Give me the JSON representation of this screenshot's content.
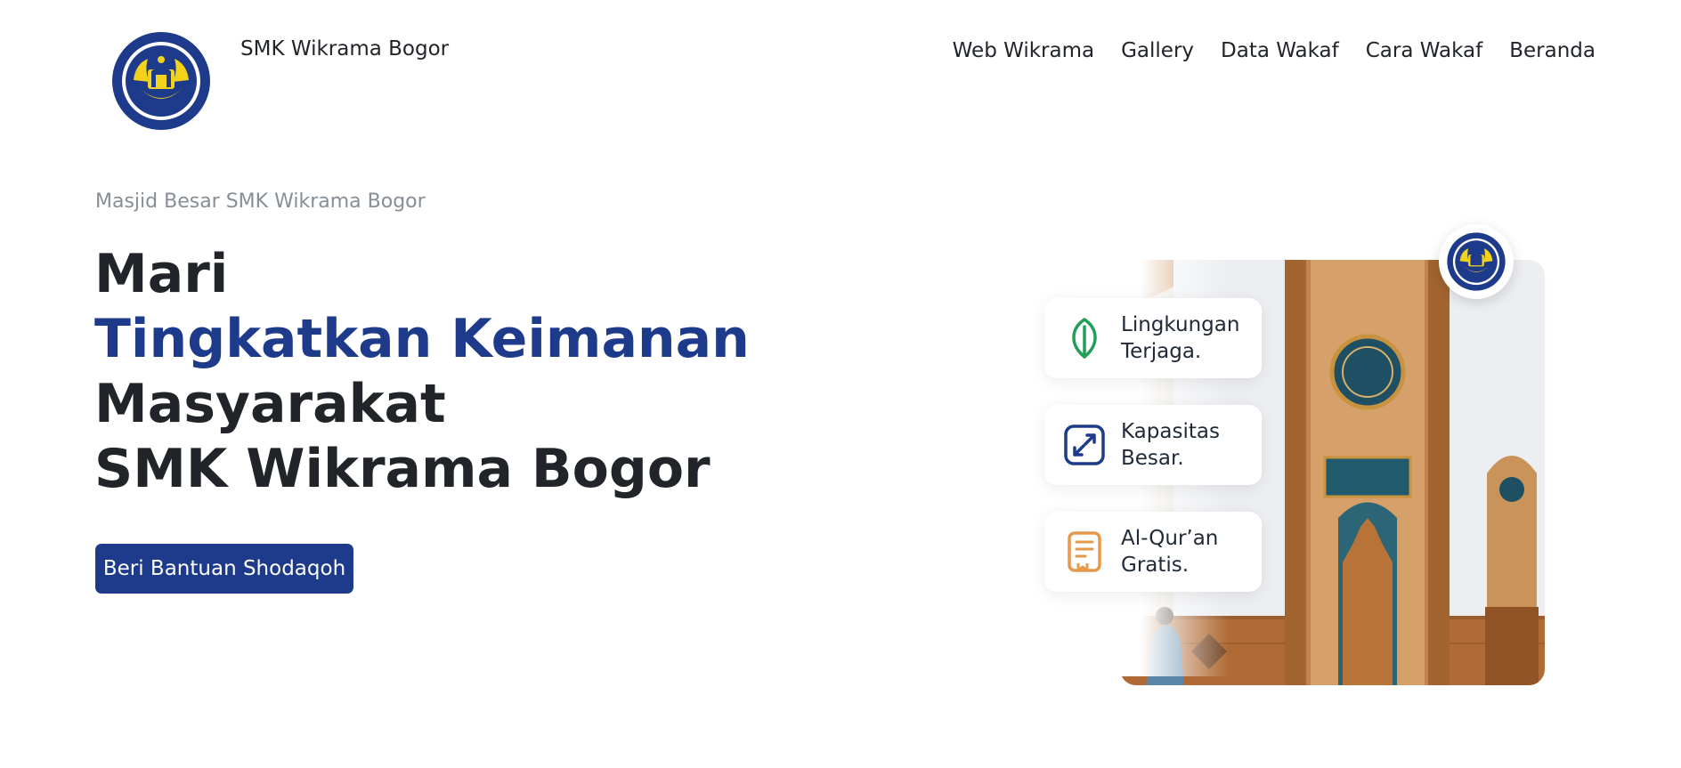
{
  "brand": {
    "name": "SMK Wikrama Bogor",
    "logo_icon": "smk-wikrama-logo"
  },
  "nav": {
    "items": [
      "Web Wikrama",
      "Gallery",
      "Data Wakaf",
      "Cara Wakaf",
      "Beranda"
    ]
  },
  "hero": {
    "eyebrow": "Masjid Besar SMK Wikrama Bogor",
    "headline": [
      "Mari",
      "Tingkatkan Keimanan",
      "Masyarakat",
      "SMK Wikrama Bogor"
    ],
    "cta_label": "Beri Bantuan Shodaqoh",
    "features": [
      {
        "line1": "Lingkungan",
        "line2": "Terjaga.",
        "icon": "leaf-icon"
      },
      {
        "line1": "Kapasitas",
        "line2": "Besar.",
        "icon": "expand-icon"
      },
      {
        "line1": "Al-Qur’an",
        "line2": "Gratis.",
        "icon": "book-icon"
      }
    ]
  },
  "colors": {
    "primary": "#1e3a8a",
    "leaf_icon": "#22a05a",
    "expand_icon": "#1e3a8a",
    "book_icon": "#e5994a"
  }
}
